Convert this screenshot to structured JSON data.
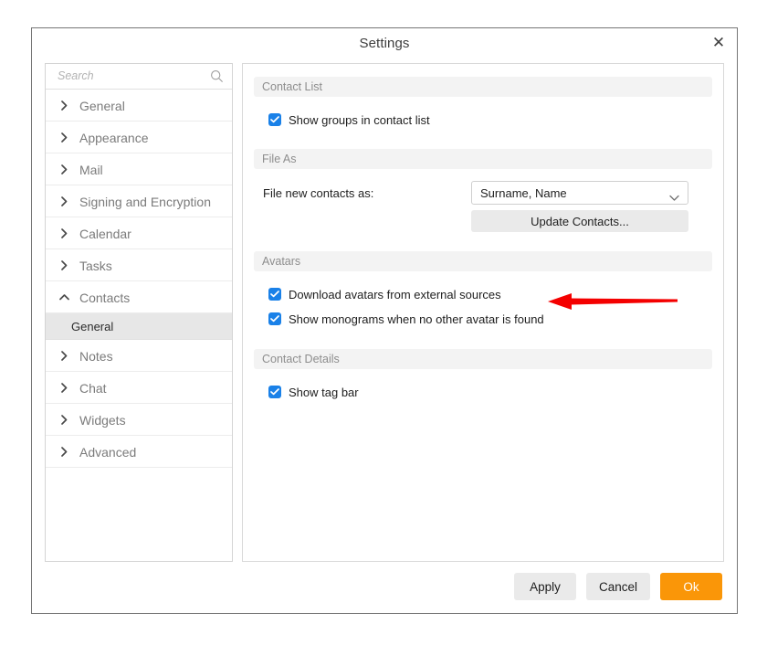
{
  "window": {
    "title": "Settings",
    "close_label": "✕"
  },
  "sidebar": {
    "search": {
      "value": "",
      "placeholder": "Search",
      "icon": "search-icon"
    },
    "items": [
      {
        "label": "General",
        "expanded": false,
        "caret": "chevron-right-icon"
      },
      {
        "label": "Appearance",
        "expanded": false,
        "caret": "chevron-right-icon"
      },
      {
        "label": "Mail",
        "expanded": false,
        "caret": "chevron-right-icon"
      },
      {
        "label": "Signing and Encryption",
        "expanded": false,
        "caret": "chevron-right-icon"
      },
      {
        "label": "Calendar",
        "expanded": false,
        "caret": "chevron-right-icon"
      },
      {
        "label": "Tasks",
        "expanded": false,
        "caret": "chevron-right-icon"
      },
      {
        "label": "Contacts",
        "expanded": true,
        "caret": "chevron-up-icon"
      },
      {
        "label": "Notes",
        "expanded": false,
        "caret": "chevron-right-icon"
      },
      {
        "label": "Chat",
        "expanded": false,
        "caret": "chevron-right-icon"
      },
      {
        "label": "Widgets",
        "expanded": false,
        "caret": "chevron-right-icon"
      },
      {
        "label": "Advanced",
        "expanded": false,
        "caret": "chevron-right-icon"
      }
    ],
    "contacts_sub_item": {
      "label": "General",
      "selected": true
    }
  },
  "content": {
    "sections": [
      {
        "header": "Contact List",
        "checkboxes": [
          {
            "label": "Show groups in contact list",
            "checked": true
          }
        ]
      },
      {
        "header": "File As",
        "field_label": "File new contacts as:",
        "select_value": "Surname, Name",
        "update_button": "Update Contacts..."
      },
      {
        "header": "Avatars",
        "checkboxes": [
          {
            "label": "Download avatars from external sources",
            "checked": true
          },
          {
            "label": "Show monograms when no other avatar is found",
            "checked": true
          }
        ]
      },
      {
        "header": "Contact Details",
        "checkboxes": [
          {
            "label": "Show tag bar",
            "checked": true
          }
        ]
      }
    ]
  },
  "footer": {
    "apply": "Apply",
    "cancel": "Cancel",
    "ok": "Ok"
  },
  "annotation": {
    "type": "arrow",
    "direction": "left",
    "color": "#f40000",
    "points_at": "Download avatars from external sources"
  },
  "colors": {
    "accent_checkbox": "#1a81e8",
    "primary_button": "#fa9608",
    "section_header_bg": "#f3f3f3",
    "selected_row_bg": "#e7e7e7",
    "annotation": "#f40000"
  }
}
